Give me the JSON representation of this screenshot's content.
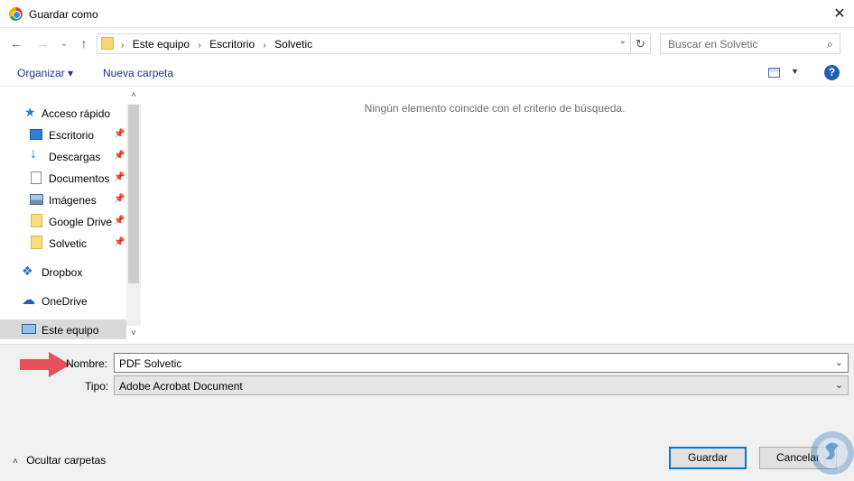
{
  "window": {
    "title": "Guardar como",
    "close_glyph": "✕"
  },
  "nav": {
    "back_glyph": "←",
    "forward_glyph": "→",
    "recent_glyph": "⌄",
    "up_glyph": "↑",
    "breadcrumbs": [
      "Este equipo",
      "Escritorio",
      "Solvetic"
    ],
    "crumb_sep": "›",
    "address_dropdown_glyph": "⌄",
    "refresh_glyph": "↻"
  },
  "search": {
    "placeholder": "Buscar en Solvetic",
    "icon_glyph": "⌕"
  },
  "toolbar": {
    "organize_label": "Organizar ▾",
    "new_folder_label": "Nueva carpeta",
    "view_dropdown_glyph": "▼",
    "help_label": "?"
  },
  "sidebar": {
    "scroll_up_glyph": "˄",
    "scroll_down_glyph": "˅",
    "pin_glyph": "📌",
    "quick_access": "Acceso rápido",
    "items": [
      {
        "label": "Escritorio",
        "icon": "desktop-icon"
      },
      {
        "label": "Descargas",
        "icon": "download-icon"
      },
      {
        "label": "Documentos",
        "icon": "documents-icon"
      },
      {
        "label": "Imágenes",
        "icon": "pictures-icon"
      },
      {
        "label": "Google Drive",
        "icon": "folder-icon"
      },
      {
        "label": "Solvetic",
        "icon": "folder-icon"
      }
    ],
    "dropbox": "Dropbox",
    "onedrive": "OneDrive",
    "this_pc": "Este equipo"
  },
  "content": {
    "empty_message": "Ningún elemento coincide con el criterio de búsqueda."
  },
  "form": {
    "name_label": "Nombre:",
    "name_value": "PDF Solvetic",
    "type_label": "Tipo:",
    "type_value": "Adobe Acrobat Document",
    "dropdown_glyph": "⌄"
  },
  "footer": {
    "hide_folders_chevron": "˄",
    "hide_folders_label": "Ocultar carpetas",
    "save_label": "Guardar",
    "cancel_label": "Cancelar"
  },
  "colors": {
    "accent": "#0078d7",
    "link": "#1e3287",
    "arrow": "#e8505b"
  }
}
